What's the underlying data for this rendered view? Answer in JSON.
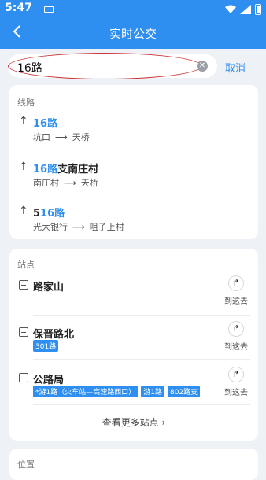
{
  "status": {
    "time": "5:47"
  },
  "header": {
    "title": "实时公交"
  },
  "search": {
    "value": "16路",
    "cancel": "取消"
  },
  "lines": {
    "section": "线路",
    "items": [
      {
        "name_prefix": "",
        "name_hl": "16路",
        "name_suffix": "",
        "from": "坑口",
        "to": "天桥"
      },
      {
        "name_prefix": "",
        "name_hl": "16路",
        "name_suffix": "支南庄村",
        "from": "南庄村",
        "to": "天桥"
      },
      {
        "name_prefix": "5",
        "name_hl": "16路",
        "name_suffix": "",
        "from": "光大银行",
        "to": "咀子上村"
      }
    ]
  },
  "stops": {
    "section": "站点",
    "go_label": "到这去",
    "items": [
      {
        "name": "路家山",
        "routes": []
      },
      {
        "name": "保晋路北",
        "routes": [
          "301路"
        ]
      },
      {
        "name": "公路局",
        "routes": [
          "*游1路（火车站—高速路西口）",
          "游1路",
          "802路支"
        ]
      }
    ],
    "more": "查看更多站点 ›"
  },
  "position": {
    "section": "位置"
  }
}
